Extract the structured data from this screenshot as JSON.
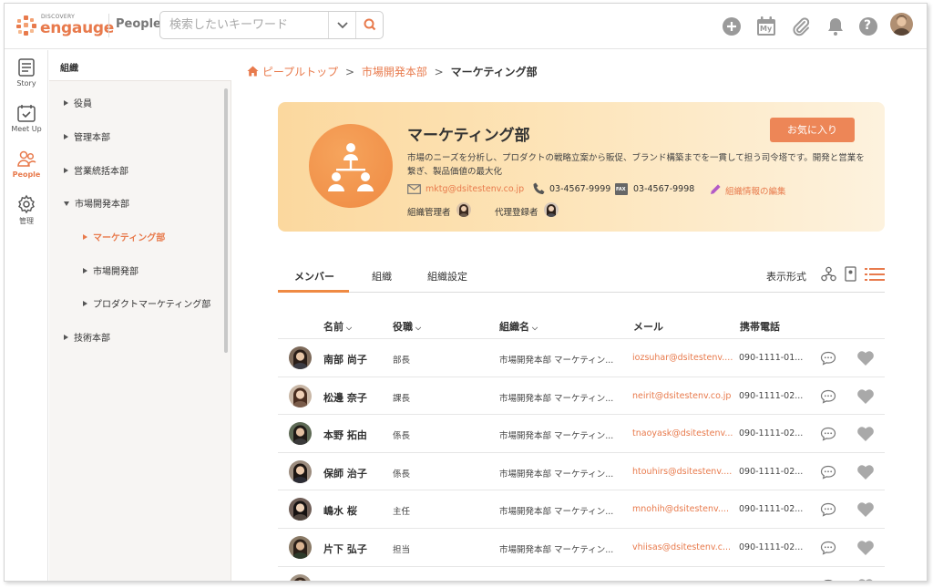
{
  "header": {
    "logo_sup": "DISCOVERY",
    "logo_text": "engauge",
    "app_name": "People",
    "search_placeholder": "検索したいキーワード"
  },
  "icons": {
    "add": "plus-circle-icon",
    "calendar": "calendar-my-icon",
    "calendar_label": "My",
    "attach": "paperclip-icon",
    "notify": "bell-icon",
    "help": "help-icon",
    "help_glyph": "?"
  },
  "rail": [
    {
      "label": "Story",
      "icon": "story-icon"
    },
    {
      "label": "Meet Up",
      "icon": "meetup-icon"
    },
    {
      "label": "People",
      "icon": "people-icon"
    },
    {
      "label": "管理",
      "icon": "settings-icon"
    }
  ],
  "tree": {
    "title": "組織",
    "items": [
      {
        "label": "役員"
      },
      {
        "label": "管理本部"
      },
      {
        "label": "営業統括本部"
      },
      {
        "label": "市場開発本部"
      },
      {
        "label": "マーケティング部"
      },
      {
        "label": "市場開発部"
      },
      {
        "label": "プロダクトマーケティング部"
      },
      {
        "label": "技術本部"
      }
    ]
  },
  "breadcrumb": {
    "home": "ピープルトップ",
    "parent": "市場開発本部",
    "current": "マーケティング部",
    "separator": ">"
  },
  "org": {
    "name": "マーケティング部",
    "favorite_label": "お気に入り",
    "description": "市場のニーズを分析し、プロダクトの戦略立案から販促、ブランド構築までを一貫して担う司令塔です。開発と営業を繋ぎ、製品価値の最大化",
    "email": "mktg@dsitestenv.co.jp",
    "phone": "03-4567-9999",
    "fax_label": "FAX",
    "fax": "03-4567-9998",
    "edit_label": "組織情報の編集",
    "manager_label": "組織管理者",
    "proxy_label": "代理登録者"
  },
  "tabs": {
    "members": "メンバー",
    "org": "組織",
    "settings": "組織設定",
    "view_format": "表示形式"
  },
  "table": {
    "headers": {
      "name": "名前",
      "position": "役職",
      "org": "組織名",
      "mail": "メール",
      "tel": "携帯電話",
      "sort_glyph": "⌵"
    },
    "rows": [
      {
        "name": "南部 尚子",
        "position": "部長",
        "org": "市場開発本部 マーケティン...",
        "mail": "iozsuhar@dsitestenv....",
        "tel": "090-1111-01..."
      },
      {
        "name": "松邊 奈子",
        "position": "課長",
        "org": "市場開発本部 マーケティン...",
        "mail": "neirit@dsitestenv.co.jp",
        "tel": "090-1111-02..."
      },
      {
        "name": "本野 拓由",
        "position": "係長",
        "org": "市場開発本部 マーケティン...",
        "mail": "tnaoyask@dsitestenv....",
        "tel": "090-1111-02..."
      },
      {
        "name": "保師 治子",
        "position": "係長",
        "org": "市場開発本部 マーケティン...",
        "mail": "htouhirs@dsitestenv....",
        "tel": "090-1111-02..."
      },
      {
        "name": "嶋水 桜",
        "position": "主任",
        "org": "市場開発本部 マーケティン...",
        "mail": "mnohih@dsitestenv....",
        "tel": "090-1111-02..."
      },
      {
        "name": "片下 弘子",
        "position": "担当",
        "org": "市場開発本部 マーケティン...",
        "mail": "vhiisas@dsitestenv.c...",
        "tel": "090-1111-02..."
      },
      {
        "name": "",
        "position": "",
        "org": "",
        "mail": "",
        "tel": ""
      }
    ]
  },
  "colors": {
    "accent": "#e87a4c",
    "button": "#ed8657",
    "icon_gray": "#9a9a9a"
  }
}
